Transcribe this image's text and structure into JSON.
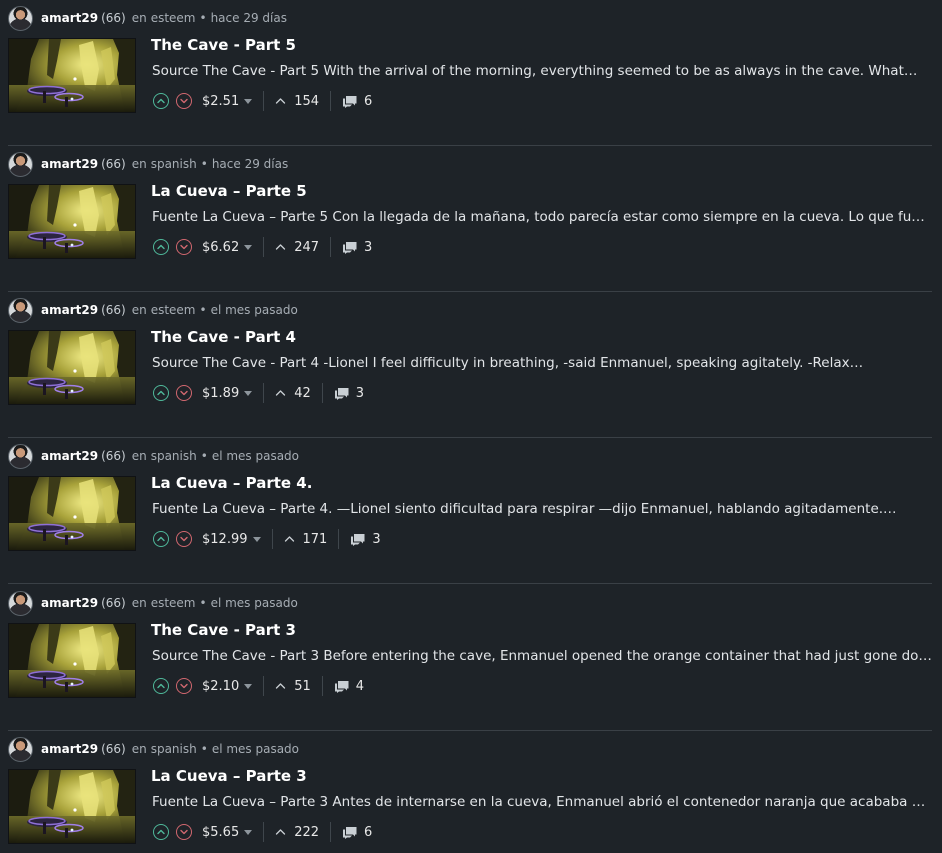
{
  "colors": {
    "background": "#1e2328",
    "upvote": "#4fb89a",
    "downvote": "#d1676f",
    "divider": "#3a4046"
  },
  "posts": [
    {
      "author": "amart29",
      "reputation": "(66)",
      "in_label": "en",
      "community": "esteem",
      "separator": "•",
      "time": "hace 29 días",
      "title": "The Cave - Part 5",
      "excerpt": "Source The Cave - Part 5 With the arrival of the morning, everything seemed to be as always in the cave. What…",
      "payout": "$2.51",
      "votes": "154",
      "comments": "6",
      "thumbnail_icon": "cave-image"
    },
    {
      "author": "amart29",
      "reputation": "(66)",
      "in_label": "en",
      "community": "spanish",
      "separator": "•",
      "time": "hace 29 días",
      "title": "La Cueva – Parte 5",
      "excerpt": "Fuente La Cueva – Parte 5 Con la llegada de la mañana, todo parecía estar como siempre en la cueva. Lo que fue…",
      "payout": "$6.62",
      "votes": "247",
      "comments": "3",
      "thumbnail_icon": "cave-image"
    },
    {
      "author": "amart29",
      "reputation": "(66)",
      "in_label": "en",
      "community": "esteem",
      "separator": "•",
      "time": "el mes pasado",
      "title": "The Cave - Part 4",
      "excerpt": "Source The Cave - Part 4 -Lionel I feel difficulty in breathing, -said Enmanuel, speaking agitately. -Relax…",
      "payout": "$1.89",
      "votes": "42",
      "comments": "3",
      "thumbnail_icon": "cave-image"
    },
    {
      "author": "amart29",
      "reputation": "(66)",
      "in_label": "en",
      "community": "spanish",
      "separator": "•",
      "time": "el mes pasado",
      "title": "La Cueva – Parte 4.",
      "excerpt": "Fuente La Cueva – Parte 4. —Lionel siento dificultad para respirar —dijo Enmanuel, hablando agitadamente.…",
      "payout": "$12.99",
      "votes": "171",
      "comments": "3",
      "thumbnail_icon": "cave-image"
    },
    {
      "author": "amart29",
      "reputation": "(66)",
      "in_label": "en",
      "community": "esteem",
      "separator": "•",
      "time": "el mes pasado",
      "title": "The Cave - Part 3",
      "excerpt": "Source The Cave - Part 3 Before entering the cave, Enmanuel opened the orange container that had just gone down…",
      "payout": "$2.10",
      "votes": "51",
      "comments": "4",
      "thumbnail_icon": "cave-image"
    },
    {
      "author": "amart29",
      "reputation": "(66)",
      "in_label": "en",
      "community": "spanish",
      "separator": "•",
      "time": "el mes pasado",
      "title": "La Cueva – Parte 3",
      "excerpt": "Fuente La Cueva – Parte 3 Antes de internarse en la cueva, Enmanuel abrió el contenedor naranja que acababa de…",
      "payout": "$5.65",
      "votes": "222",
      "comments": "6",
      "thumbnail_icon": "cave-image"
    }
  ]
}
